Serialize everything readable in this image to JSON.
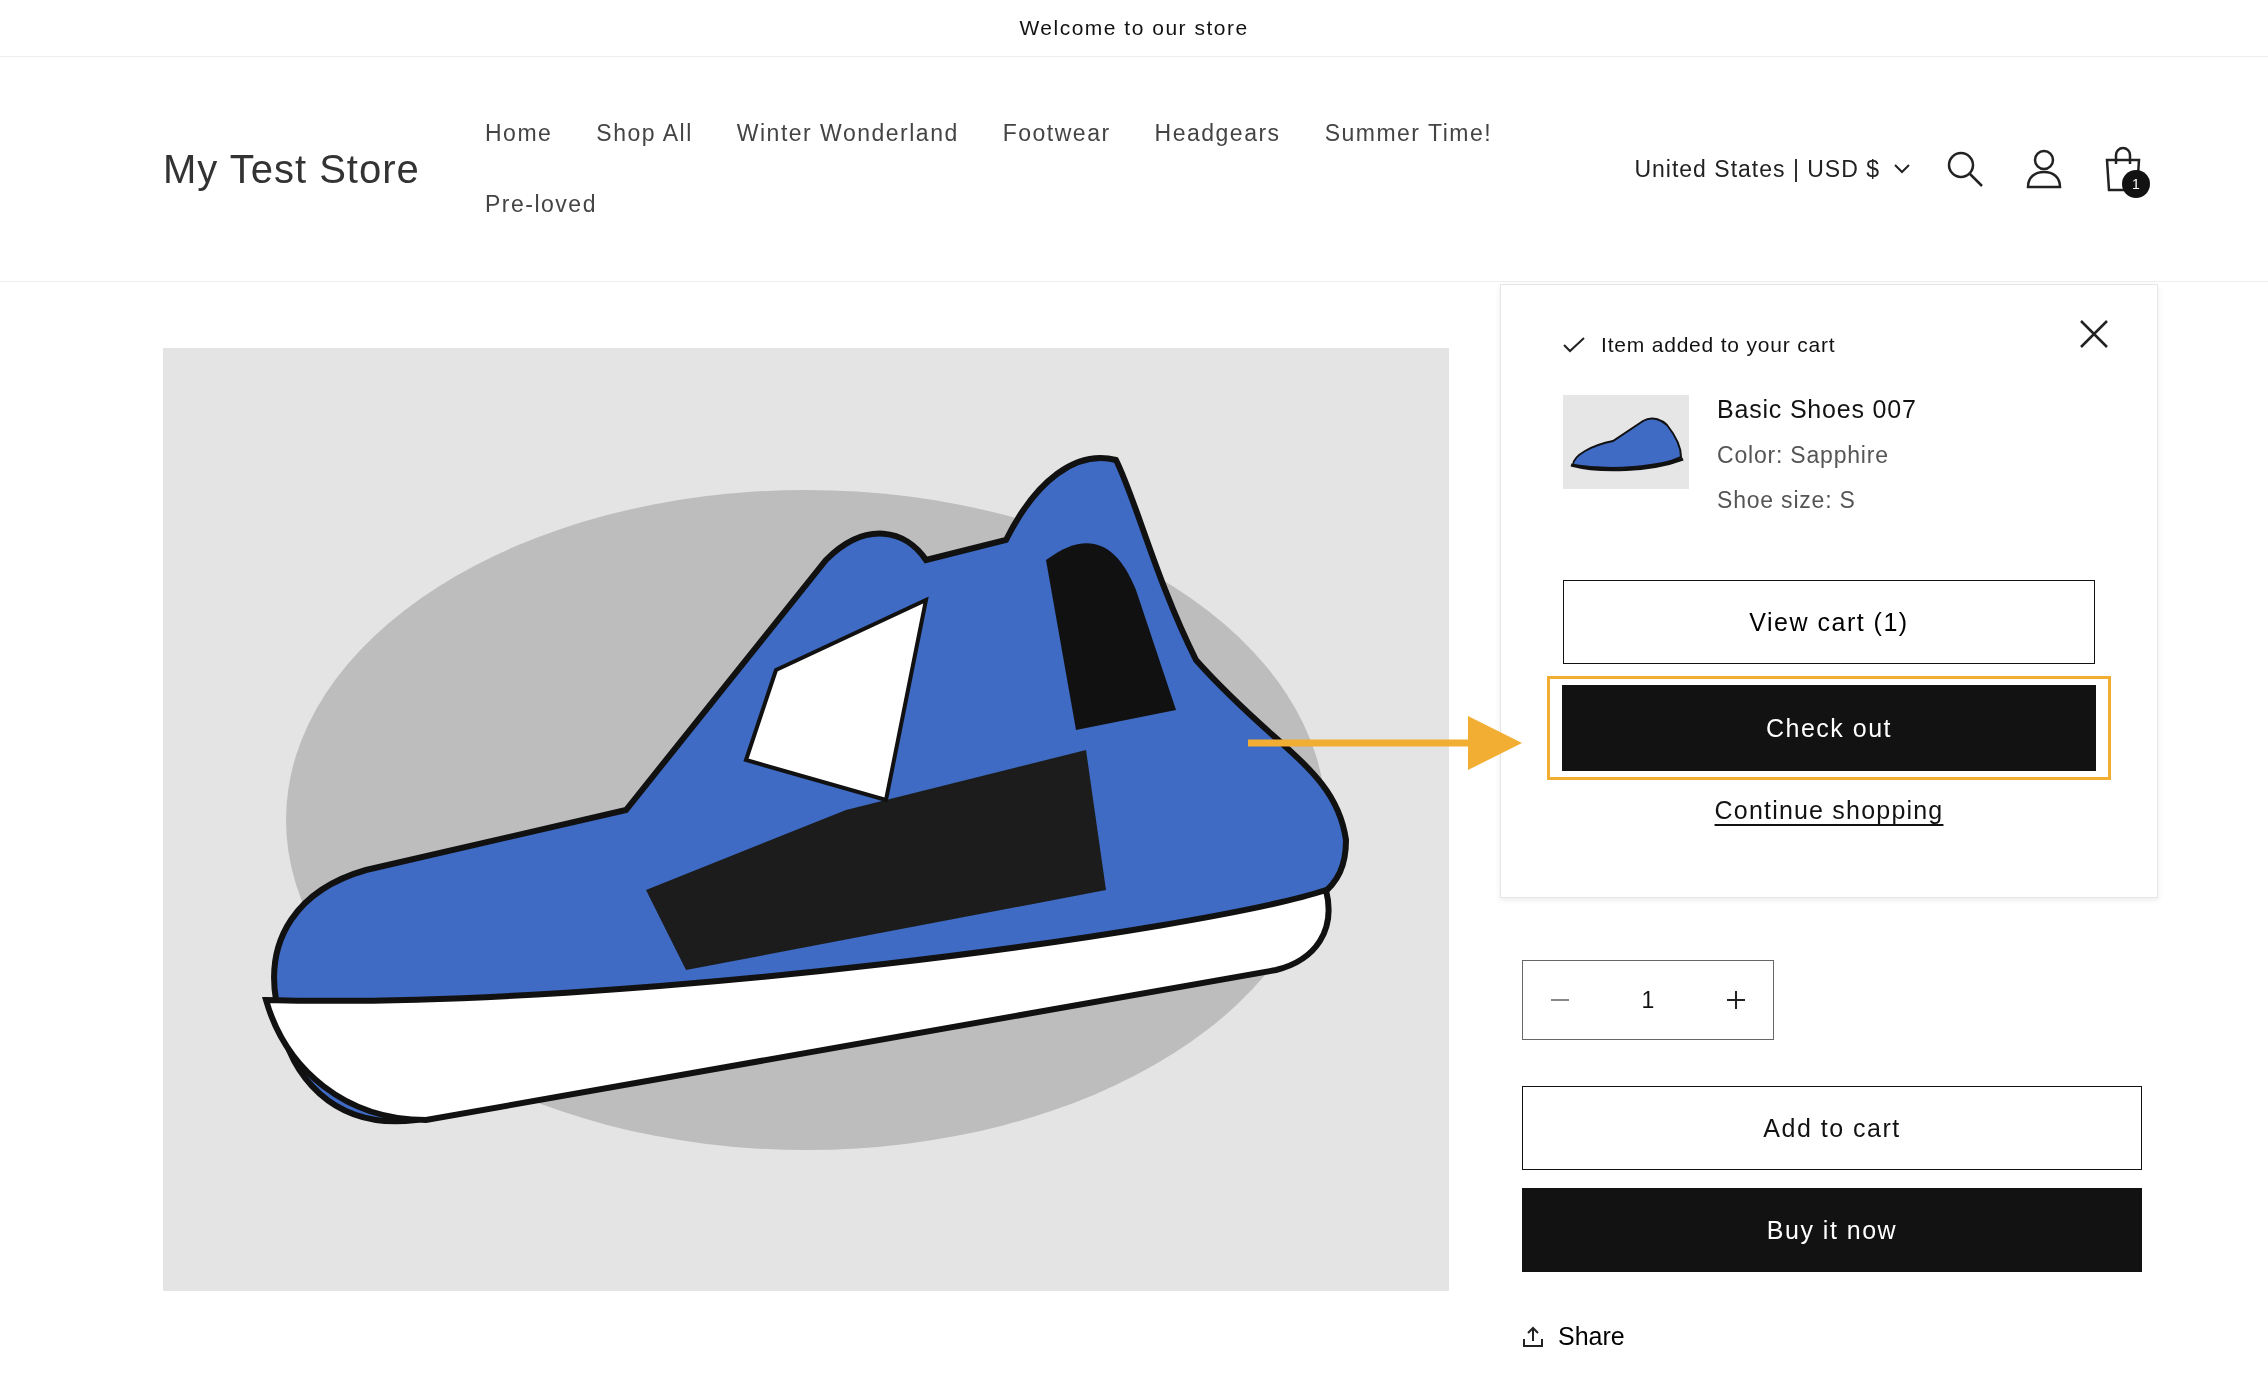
{
  "announcement": "Welcome to our store",
  "header": {
    "store_name": "My Test Store",
    "nav": [
      "Home",
      "Shop All",
      "Winter Wonderland",
      "Footwear",
      "Headgears",
      "Summer Time!",
      "Pre-loved"
    ],
    "localization": "United States | USD $",
    "cart_count": "1"
  },
  "cart_notification": {
    "message": "Item added to your cart",
    "product_title": "Basic Shoes 007",
    "options": [
      "Color: Sapphire",
      "Shoe size: S"
    ],
    "view_cart": "View cart (1)",
    "checkout": "Check out",
    "continue": "Continue shopping"
  },
  "product": {
    "quantity": "1",
    "add_to_cart": "Add to cart",
    "buy_now": "Buy it now",
    "share": "Share"
  }
}
